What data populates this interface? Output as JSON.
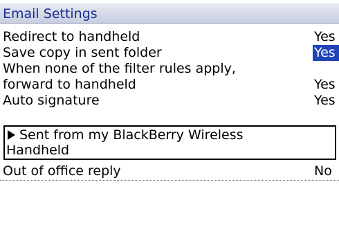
{
  "screen": {
    "title": "Email Settings"
  },
  "settings": [
    {
      "label": "Redirect to handheld",
      "value": "Yes"
    },
    {
      "label": "Save copy in sent folder",
      "value": "Yes"
    },
    {
      "label": "When none of the filter rules apply,",
      "value": ""
    },
    {
      "label": "forward to handheld",
      "value": "Yes"
    },
    {
      "label": "Auto signature",
      "value": "Yes"
    },
    {
      "label": "Out of office reply",
      "value": "No"
    }
  ],
  "signature": {
    "line1": "Sent from my BlackBerry Wireless",
    "line2": "Handheld"
  },
  "colors": {
    "title_text": "#1b2b96",
    "selection": "#1f44b8"
  }
}
